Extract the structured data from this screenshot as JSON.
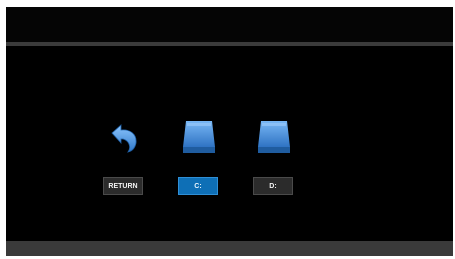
{
  "drive_selector": {
    "items": [
      {
        "label": "RETURN",
        "icon": "return-arrow-icon",
        "selected": false
      },
      {
        "label": "C:",
        "icon": "drive-icon",
        "selected": true
      },
      {
        "label": "D:",
        "icon": "drive-icon",
        "selected": false
      }
    ]
  },
  "colors": {
    "background": "#000000",
    "divider": "#3b3b3b",
    "bottom_bar": "#3a3a3a",
    "icon_blue": "#4a8fd8",
    "selected_label_bg": "#0e6fb6",
    "label_bg": "#2b2b2b"
  }
}
